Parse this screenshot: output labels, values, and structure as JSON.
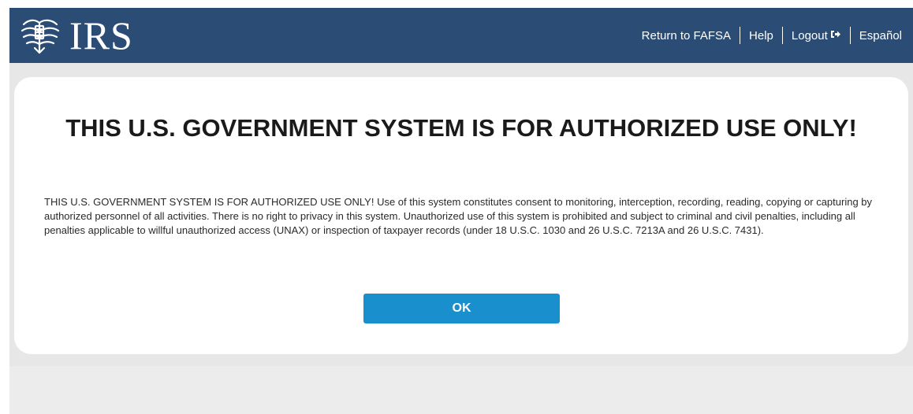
{
  "header": {
    "logo_text": "IRS",
    "logo_icon": "irs-eagle-icon",
    "nav": {
      "return_label": "Return to FAFSA",
      "help_label": "Help",
      "logout_label": "Logout",
      "logout_icon": "sign-out-icon",
      "language_label": "Español"
    },
    "background_color": "#2b4c74"
  },
  "dialog": {
    "title": "THIS U.S. GOVERNMENT SYSTEM IS FOR AUTHORIZED USE ONLY!",
    "body": "THIS U.S. GOVERNMENT SYSTEM IS FOR AUTHORIZED USE ONLY! Use of this system constitutes consent to monitoring, interception, recording, reading, copying or capturing by authorized personnel of all activities. There is no right to privacy in this system. Unauthorized use of this system is prohibited and subject to criminal and civil penalties, including all penalties applicable to willful unauthorized access (UNAX) or inspection of taxpayer records (under 18 U.S.C. 1030 and 26 U.S.C. 7213A and 26 U.S.C. 7431).",
    "ok_label": "OK",
    "button_color": "#1a8fce"
  }
}
